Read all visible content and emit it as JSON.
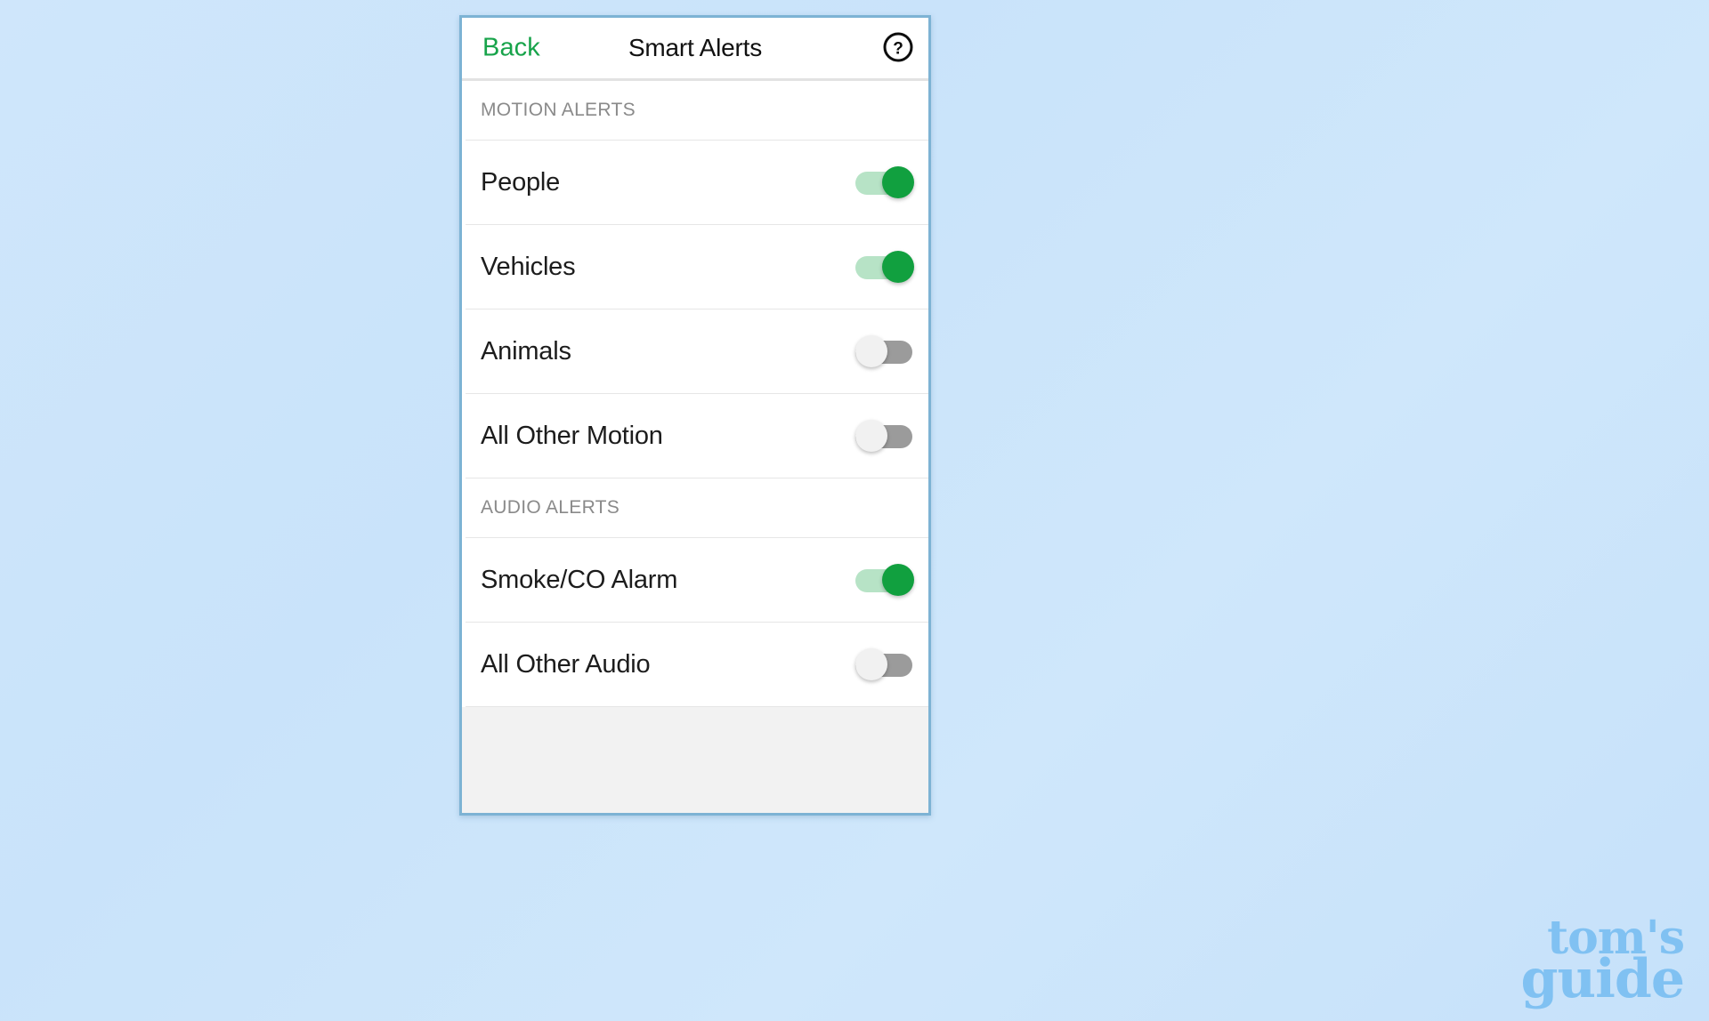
{
  "background": {
    "color_start": "#cfe6fb",
    "color_end": "#c6e1fa"
  },
  "phone": {
    "border_color": "#7db3d4",
    "nav": {
      "back_label": "Back",
      "title": "Smart Alerts",
      "help_icon": "question-mark-circle-icon",
      "back_color": "#17a34a",
      "title_color": "#111111"
    },
    "sections": [
      {
        "header": "MOTION ALERTS",
        "rows": [
          {
            "label": "People",
            "state": "on"
          },
          {
            "label": "Vehicles",
            "state": "on"
          },
          {
            "label": "Animals",
            "state": "off"
          },
          {
            "label": "All Other Motion",
            "state": "off"
          }
        ]
      },
      {
        "header": "AUDIO ALERTS",
        "rows": [
          {
            "label": "Smoke/CO Alarm",
            "state": "on"
          },
          {
            "label": "All Other Audio",
            "state": "off"
          }
        ]
      }
    ],
    "toggle_colors": {
      "on_track": "#b7e3c6",
      "on_knob": "#11a03f",
      "off_track": "#9b9b9b",
      "off_knob": "#f1f1f1"
    },
    "footer_fill_color": "#f2f2f2"
  },
  "watermark": {
    "line1": "tom's",
    "line2": "guide",
    "color": "#7dc0f2"
  }
}
